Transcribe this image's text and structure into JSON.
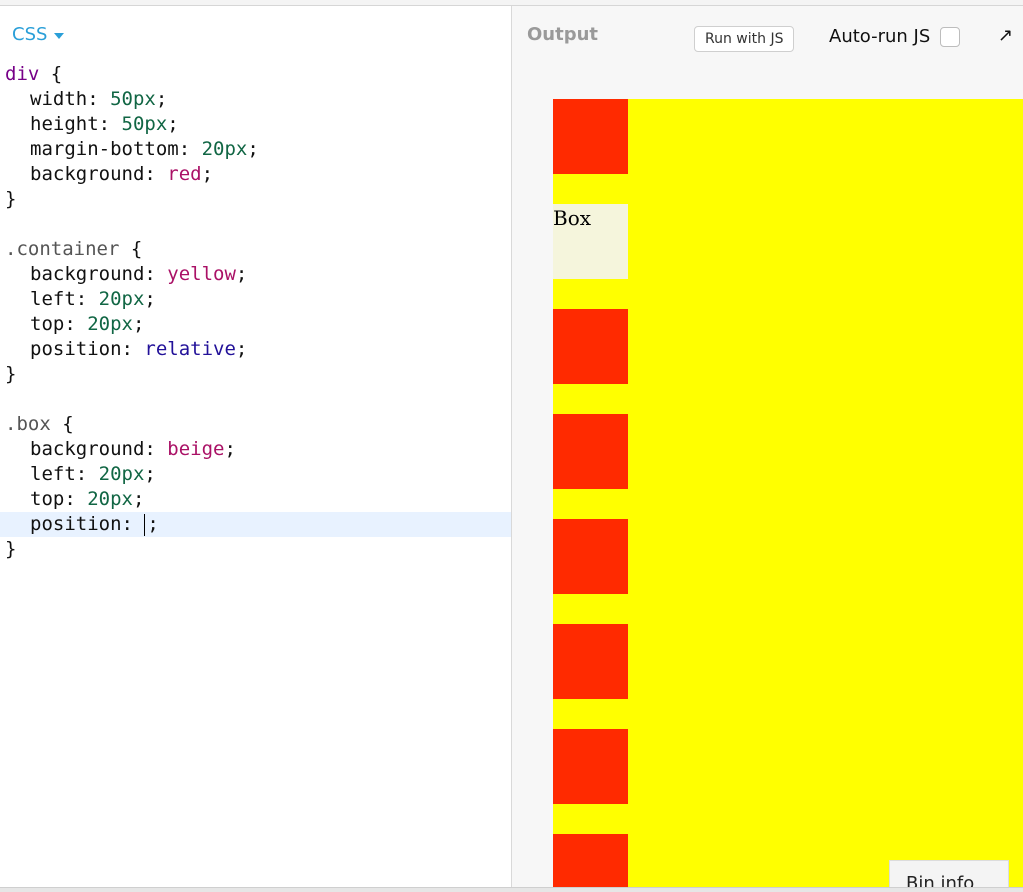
{
  "editor": {
    "language_label": "CSS",
    "lines": [
      {
        "indent": false,
        "parts": [
          {
            "t": "div",
            "c": "sel"
          },
          {
            "t": " {",
            "c": ""
          }
        ]
      },
      {
        "indent": true,
        "parts": [
          {
            "t": "width: ",
            "c": ""
          },
          {
            "t": "50px",
            "c": "num"
          },
          {
            "t": ";",
            "c": ""
          }
        ]
      },
      {
        "indent": true,
        "parts": [
          {
            "t": "height: ",
            "c": ""
          },
          {
            "t": "50px",
            "c": "num"
          },
          {
            "t": ";",
            "c": ""
          }
        ]
      },
      {
        "indent": true,
        "parts": [
          {
            "t": "margin-bottom: ",
            "c": ""
          },
          {
            "t": "20px",
            "c": "num"
          },
          {
            "t": ";",
            "c": ""
          }
        ]
      },
      {
        "indent": true,
        "parts": [
          {
            "t": "background: ",
            "c": ""
          },
          {
            "t": "red",
            "c": "val"
          },
          {
            "t": ";",
            "c": ""
          }
        ]
      },
      {
        "indent": false,
        "parts": [
          {
            "t": "}",
            "c": ""
          }
        ]
      },
      {
        "indent": false,
        "parts": [
          {
            "t": "",
            "c": ""
          }
        ]
      },
      {
        "indent": false,
        "parts": [
          {
            "t": ".container",
            "c": "cls"
          },
          {
            "t": " {",
            "c": ""
          }
        ]
      },
      {
        "indent": true,
        "parts": [
          {
            "t": "background: ",
            "c": ""
          },
          {
            "t": "yellow",
            "c": "val"
          },
          {
            "t": ";",
            "c": ""
          }
        ]
      },
      {
        "indent": true,
        "parts": [
          {
            "t": "left: ",
            "c": ""
          },
          {
            "t": "20px",
            "c": "num"
          },
          {
            "t": ";",
            "c": ""
          }
        ]
      },
      {
        "indent": true,
        "parts": [
          {
            "t": "top: ",
            "c": ""
          },
          {
            "t": "20px",
            "c": "num"
          },
          {
            "t": ";",
            "c": ""
          }
        ]
      },
      {
        "indent": true,
        "parts": [
          {
            "t": "position: ",
            "c": ""
          },
          {
            "t": "relative",
            "c": "kw"
          },
          {
            "t": ";",
            "c": ""
          }
        ]
      },
      {
        "indent": false,
        "parts": [
          {
            "t": "}",
            "c": ""
          }
        ]
      },
      {
        "indent": false,
        "parts": [
          {
            "t": "",
            "c": ""
          }
        ]
      },
      {
        "indent": false,
        "parts": [
          {
            "t": ".box",
            "c": "cls"
          },
          {
            "t": " {",
            "c": ""
          }
        ]
      },
      {
        "indent": true,
        "parts": [
          {
            "t": "background: ",
            "c": ""
          },
          {
            "t": "beige",
            "c": "val"
          },
          {
            "t": ";",
            "c": ""
          }
        ]
      },
      {
        "indent": true,
        "parts": [
          {
            "t": "left: ",
            "c": ""
          },
          {
            "t": "20px",
            "c": "num"
          },
          {
            "t": ";",
            "c": ""
          }
        ]
      },
      {
        "indent": true,
        "parts": [
          {
            "t": "top: ",
            "c": ""
          },
          {
            "t": "20px",
            "c": "num"
          },
          {
            "t": ";",
            "c": ""
          }
        ]
      },
      {
        "indent": true,
        "active": true,
        "parts": [
          {
            "t": "position: ",
            "c": ""
          },
          {
            "t": "|cursor|",
            "c": "cursor"
          },
          {
            "t": ";",
            "c": ""
          }
        ]
      },
      {
        "indent": false,
        "parts": [
          {
            "t": "}",
            "c": ""
          }
        ]
      }
    ]
  },
  "output": {
    "label": "Output",
    "run_button": "Run with JS",
    "autorun_label": "Auto-run JS",
    "popout_icon": "↗",
    "box_text": "Box",
    "bin_info": "Bin info"
  },
  "colors": {
    "accent": "#2a9fd8",
    "container_bg": "#ffff00",
    "red_block": "#ff2a00",
    "beige_block": "#f5f5dc"
  }
}
